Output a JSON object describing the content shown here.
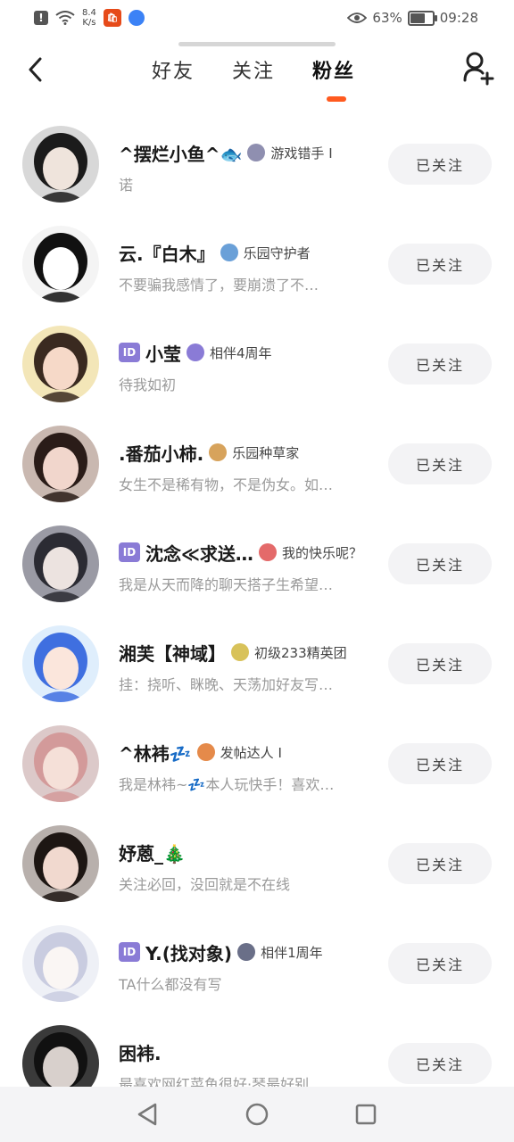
{
  "status_bar": {
    "net_speed_value": "8.4",
    "net_speed_unit": "K/s",
    "battery": "63%",
    "battery_level": 0.63,
    "time": "09:28"
  },
  "header": {
    "tabs": [
      {
        "label": "好友",
        "active": false
      },
      {
        "label": "关注",
        "active": false
      },
      {
        "label": "粉丝",
        "active": true
      }
    ],
    "accent_color": "#ff5a1f"
  },
  "fans": [
    {
      "has_id": false,
      "name": "^摆烂小鱼^🐟",
      "medal_color": "#8f8fb0",
      "tag": "游戏错手 I",
      "bio": "诺",
      "button": "已关注",
      "avatar": {
        "bg": "#d8d8d8",
        "hair": "#1b1b1b",
        "skin": "#efe4dc"
      }
    },
    {
      "has_id": false,
      "name": "云.『白木』",
      "medal_color": "#6aa0d8",
      "tag": "乐园守护者",
      "bio": "不要骗我感情了，要崩溃了不…",
      "button": "已关注",
      "avatar": {
        "bg": "#f4f4f4",
        "hair": "#111111",
        "skin": "#ffffff"
      }
    },
    {
      "has_id": true,
      "name": "小莹",
      "medal_color": "#8a7bd6",
      "tag": "相伴4周年",
      "bio": "待我如初",
      "button": "已关注",
      "avatar": {
        "bg": "#f3e6b8",
        "hair": "#3a2a20",
        "skin": "#f6d9c8"
      }
    },
    {
      "has_id": false,
      "name": ".番茄小柿.",
      "medal_color": "#d7a35c",
      "tag": "乐园种草家",
      "bio": "女生不是稀有物，不是伪女。如…",
      "button": "已关注",
      "avatar": {
        "bg": "#c9b8b0",
        "hair": "#2a1c18",
        "skin": "#f1d6cc"
      }
    },
    {
      "has_id": true,
      "name": "沈念≪求送…",
      "medal_color": "#e46a6a",
      "tag": "我的快乐呢？",
      "bio": "我是从天而降的聊天搭子生希望…",
      "button": "已关注",
      "avatar": {
        "bg": "#9a9aa4",
        "hair": "#2b2b33",
        "skin": "#ece3e0"
      }
    },
    {
      "has_id": false,
      "name": "湘芙【神域】",
      "medal_color": "#d8c25a",
      "tag": "初级233精英团",
      "bio": "挂：挠听、眯晚、天荡加好友写…",
      "button": "已关注",
      "avatar": {
        "bg": "#dfeefc",
        "hair": "#3f6fe0",
        "skin": "#fbe6dc"
      }
    },
    {
      "has_id": false,
      "name": "^林袆💤",
      "medal_color": "#e58a4a",
      "tag": "发帖达人 I",
      "bio": "我是林袆~💤本人玩快手！喜欢…",
      "button": "已关注",
      "avatar": {
        "bg": "#dcc9c9",
        "hair": "#d39a9a",
        "skin": "#f5e0d8"
      }
    },
    {
      "has_id": false,
      "name": "妤蒽_🎄",
      "medal_color": "",
      "tag": "",
      "bio": "关注必回，没回就是不在线",
      "button": "已关注",
      "avatar": {
        "bg": "#b8b0ac",
        "hair": "#1d1613",
        "skin": "#f1d9cf"
      }
    },
    {
      "has_id": true,
      "name": "Y.(找对象)",
      "medal_color": "#6a6f88",
      "tag": "相伴1周年",
      "bio": "TA什么都没有写",
      "button": "已关注",
      "avatar": {
        "bg": "#eef0f6",
        "hair": "#c9cce0",
        "skin": "#faf6f4"
      }
    },
    {
      "has_id": false,
      "name": "困袆.",
      "medal_color": "",
      "tag": "",
      "bio": "最喜欢网红菜鱼很好·琴最好别…",
      "button": "已关注",
      "avatar": {
        "bg": "#3a3a3a",
        "hair": "#111111",
        "skin": "#d8d0cc"
      }
    }
  ]
}
